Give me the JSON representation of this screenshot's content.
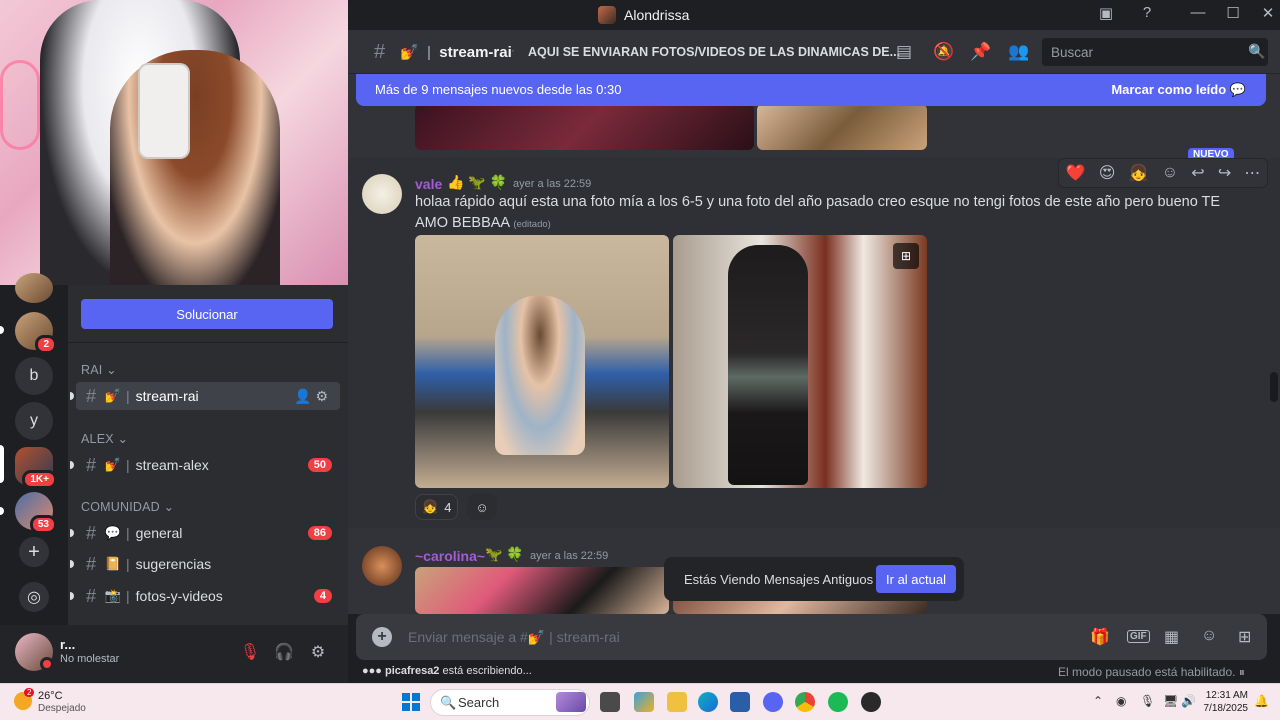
{
  "window": {
    "title": "Alondrissa",
    "minimize": "—",
    "maximize": "☐",
    "close": "✕"
  },
  "server_rail": {
    "letters": [
      "b",
      "y"
    ],
    "badges": [
      "2",
      "1K+",
      "53"
    ],
    "add_glyph": "+",
    "explore_glyph": "◎"
  },
  "sidebar": {
    "fix_button": "Solucionar",
    "categories": [
      "RAI",
      "ALEX",
      "COMUNIDAD"
    ],
    "channels": [
      {
        "name": "stream-rai",
        "emoji": "💅",
        "count": ""
      },
      {
        "name": "stream-alex",
        "emoji": "💅",
        "count": "50"
      },
      {
        "name": "general",
        "emoji": "💬",
        "count": "86"
      },
      {
        "name": "sugerencias",
        "emoji": "📔",
        "count": ""
      },
      {
        "name": "fotos-y-videos",
        "emoji": "📸",
        "count": "4"
      }
    ],
    "active_tools": "⚙"
  },
  "user_panel": {
    "name": "r...",
    "status": "No molestar"
  },
  "channel_header": {
    "channel": "stream-rai",
    "channel_emoji": "💅",
    "topic": "AQUI SE ENVIARAN FOTOS/VIDEOS DE LAS DINAMICAS DE...",
    "search_placeholder": "Buscar"
  },
  "new_messages_bar": {
    "left": "Más de 9 mensajes nuevos desde las 0:30",
    "right": "Marcar como leído"
  },
  "messages": [
    {
      "author": "vale",
      "author_color": "#a45bd6",
      "timestamp": "ayer a las 22:59",
      "text": "holaa rápido aquí esta una foto mía a los 6-5 y una foto del año pasado creo esque no tengi fotos de este año pero bueno TE AMO BEBBAA",
      "edited": "(editado)",
      "reaction_count": "4",
      "new_badge": "NUEVO"
    },
    {
      "author": "~carolina~",
      "author_color": "#a45bd6",
      "timestamp": "ayer a las 22:59"
    }
  ],
  "old_messages_toast": {
    "text": "Estás Viendo Mensajes Antiguos",
    "button": "Ir al actual"
  },
  "composer": {
    "placeholder": "Enviar mensaje a #💅 | stream-rai",
    "gif_label": "GIF"
  },
  "typing": {
    "user": "picafresa2",
    "suffix": "está escribiendo..."
  },
  "paused": "El modo pausado está habilitado.",
  "taskbar": {
    "weather_temp": "26°C",
    "weather_cond": "Despejado",
    "weather_badge": "2",
    "search_label": "Search",
    "time": "12:31 AM",
    "date": "7/18/2025"
  },
  "colors": {
    "accent": "#5865f2",
    "danger": "#f23f43",
    "bg_chat": "#313338",
    "bg_sidebar": "#2b2d31"
  }
}
